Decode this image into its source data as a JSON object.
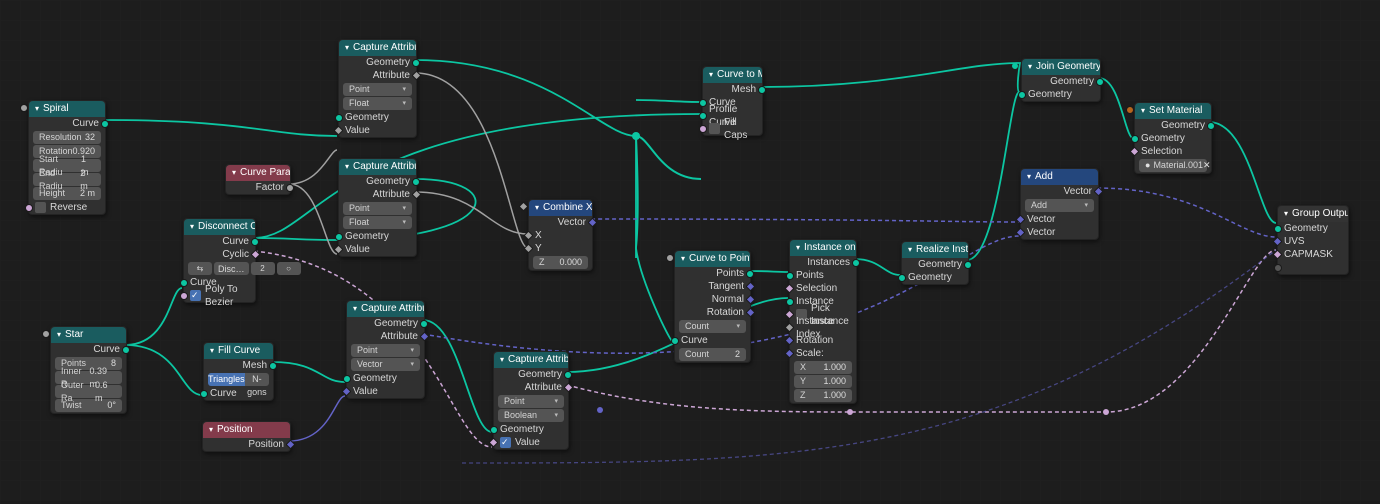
{
  "nodes": {
    "spiral": {
      "title": "Spiral",
      "out_curve": "Curve",
      "resolution_l": "Resolution",
      "resolution_v": "32",
      "rotation_l": "Rotation",
      "rotation_v": "0.920",
      "startr_l": "Start Radiu",
      "startr_v": "1 m",
      "endr_l": "End Radiu",
      "endr_v": "2 m",
      "height_l": "Height",
      "height_v": "2 m",
      "reverse": "Reverse"
    },
    "curve_param": {
      "title": "Curve Parameter",
      "factor": "Factor"
    },
    "disconnect": {
      "title": "Disconnect Cycl",
      "out_curve": "Curve",
      "out_cyclic": "Cyclic",
      "btn_disc": "Disc…",
      "in_curve": "Curve",
      "poly_to_bezier": "Poly To Bezier"
    },
    "star": {
      "title": "Star",
      "out_curve": "Curve",
      "points_l": "Points",
      "points_v": "8",
      "inner_l": "Inner R",
      "inner_v": "0.39 m",
      "outer_l": "Outer Ra",
      "outer_v": "0.6 m",
      "twist_l": "Twist",
      "twist_v": "0°"
    },
    "fill_curve": {
      "title": "Fill Curve",
      "out_mesh": "Mesh",
      "tri": "Triangles",
      "ngon": "N-gons",
      "in_curve": "Curve"
    },
    "position": {
      "title": "Position",
      "out": "Position"
    },
    "cap1": {
      "title": "Capture Attribute",
      "out_geo": "Geometry",
      "out_attr": "Attribute",
      "domain": "Point",
      "dtype": "Float",
      "in_geo": "Geometry",
      "in_val": "Value"
    },
    "cap2": {
      "title": "Capture Attribute",
      "out_geo": "Geometry",
      "out_attr": "Attribute",
      "domain": "Point",
      "dtype": "Float",
      "in_geo": "Geometry",
      "in_val": "Value"
    },
    "cap3": {
      "title": "Capture Attribute",
      "out_geo": "Geometry",
      "out_attr": "Attribute",
      "domain": "Point",
      "dtype": "Vector",
      "in_geo": "Geometry",
      "in_val": "Value"
    },
    "cap4": {
      "title": "Capture Attribute",
      "out_geo": "Geometry",
      "out_attr": "Attribute",
      "domain": "Point",
      "dtype": "Boolean",
      "in_geo": "Geometry",
      "in_val": "Value"
    },
    "combine": {
      "title": "Combine XYZ",
      "out": "Vector",
      "x": "X",
      "y": "Y",
      "z_l": "Z",
      "z_v": "0.000"
    },
    "c2m": {
      "title": "Curve to Mesh",
      "out_mesh": "Mesh",
      "in_curve": "Curve",
      "in_profile": "Profile Curve",
      "fill": "Fill Caps"
    },
    "c2p": {
      "title": "Curve to Points",
      "out_pts": "Points",
      "out_tan": "Tangent",
      "out_nrm": "Normal",
      "out_rot": "Rotation",
      "mode": "Count",
      "in_curve": "Curve",
      "count_l": "Count",
      "count_v": "2"
    },
    "iop": {
      "title": "Instance on Points",
      "out": "Instances",
      "in_points": "Points",
      "in_sel": "Selection",
      "in_inst": "Instance",
      "pick": "Pick Instance",
      "in_idx": "Instance Index",
      "in_rot": "Rotation",
      "scale_l": "Scale:",
      "sx_l": "X",
      "sx_v": "1.000",
      "sy_l": "Y",
      "sy_v": "1.000",
      "sz_l": "Z",
      "sz_v": "1.000"
    },
    "realize": {
      "title": "Realize Instances",
      "out": "Geometry",
      "in": "Geometry"
    },
    "join": {
      "title": "Join Geometry",
      "out": "Geometry",
      "in": "Geometry"
    },
    "add": {
      "title": "Add",
      "out": "Vector",
      "op": "Add",
      "in1": "Vector",
      "in2": "Vector"
    },
    "setmat": {
      "title": "Set Material",
      "out": "Geometry",
      "in_geo": "Geometry",
      "in_sel": "Selection",
      "mat": "Material.001"
    },
    "group_out": {
      "title": "Group Output",
      "geo": "Geometry",
      "uvs": "UVS",
      "cap": "CAPMASK"
    }
  }
}
